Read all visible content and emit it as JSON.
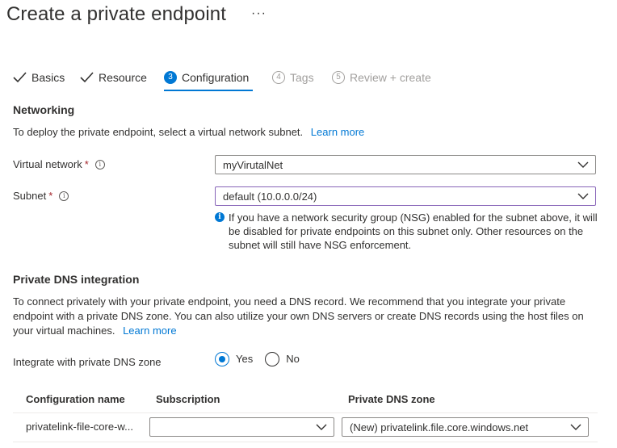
{
  "header": {
    "title": "Create a private endpoint",
    "more": "···"
  },
  "steps": [
    {
      "label": "Basics",
      "state": "done"
    },
    {
      "label": "Resource",
      "state": "done"
    },
    {
      "num": "3",
      "label": "Configuration",
      "state": "active"
    },
    {
      "num": "4",
      "label": "Tags",
      "state": "disabled"
    },
    {
      "num": "5",
      "label": "Review + create",
      "state": "disabled"
    }
  ],
  "networking": {
    "heading": "Networking",
    "description": "To deploy the private endpoint, select a virtual network subnet.",
    "learn_more": "Learn more",
    "vnet_label": "Virtual network",
    "vnet_value": "myVirutalNet",
    "subnet_label": "Subnet",
    "subnet_value": "default (10.0.0.0/24)",
    "required_mark": "*",
    "info_text": "If you have a network security group (NSG) enabled for the subnet above, it will be disabled for private endpoints on this subnet only. Other resources on the subnet will still have NSG enforcement."
  },
  "dns": {
    "heading": "Private DNS integration",
    "description_line1": "To connect privately with your private endpoint, you need a DNS record. We recommend that you integrate your private",
    "description_line2": "endpoint with a private DNS zone. You can also utilize your own DNS servers or create DNS records using the host files on",
    "description_line3": "your virtual machines.",
    "learn_more": "Learn more",
    "integrate_label": "Integrate with private DNS zone",
    "option_yes": "Yes",
    "option_no": "No",
    "selected": "Yes"
  },
  "table": {
    "headers": [
      "Configuration name",
      "Subscription",
      "Private DNS zone"
    ],
    "rows": [
      {
        "config_name": "privatelink-file-core-w...",
        "subscription": "",
        "dns_zone": "(New) privatelink.file.core.windows.net"
      }
    ]
  },
  "colors": {
    "accent": "#0078d4",
    "required": "#a4262c",
    "focus": "#8764b8"
  }
}
